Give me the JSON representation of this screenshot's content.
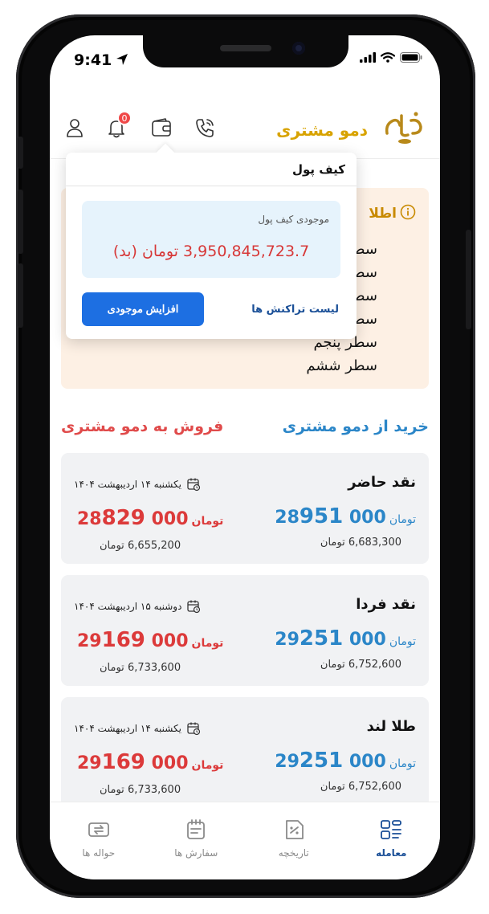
{
  "status_bar": {
    "time": "9:41"
  },
  "header": {
    "app_title": "دمو مشتری",
    "notification_count": "0"
  },
  "wallet_popup": {
    "title": "کیف پول",
    "balance_label": "موجودی کیف پول",
    "balance_amount": "3,950,845,723.7 تومان (بد)",
    "increase_button": "افزایش موجودی",
    "transactions_link": "لیست تراکنش ها"
  },
  "info_box": {
    "title": "اطلا",
    "lines": [
      "سطر",
      "سطر",
      "سطر",
      "سطر",
      "سطر پنجم",
      "سطر ششم"
    ]
  },
  "sections": {
    "buy_title": "خرید از دمو مشتری",
    "sell_title": "فروش به دمو مشتری"
  },
  "cards": [
    {
      "name": "نقد حاضر",
      "date": "یکشنبه ۱۴ اردیبهشت ۱۴۰۴",
      "buy_price_lead": "28",
      "buy_price_main": "951",
      "buy_price_tail": "000",
      "buy_unit": "تومان",
      "buy_sub": "6,683,300 تومان",
      "sell_price_lead": "28",
      "sell_price_main": "829",
      "sell_price_tail": "000",
      "sell_unit": "تومان",
      "sell_sub": "6,655,200 تومان"
    },
    {
      "name": "نقد فردا",
      "date": "دوشنبه ۱۵ اردیبهشت ۱۴۰۴",
      "buy_price_lead": "29",
      "buy_price_main": "251",
      "buy_price_tail": "000",
      "buy_unit": "تومان",
      "buy_sub": "6,752,600 تومان",
      "sell_price_lead": "29",
      "sell_price_main": "169",
      "sell_price_tail": "000",
      "sell_unit": "تومان",
      "sell_sub": "6,733,600 تومان"
    },
    {
      "name": "طلا لند",
      "date": "یکشنبه ۱۴ اردیبهشت ۱۴۰۴",
      "buy_price_lead": "29",
      "buy_price_main": "251",
      "buy_price_tail": "000",
      "buy_unit": "تومان",
      "buy_sub": "6,752,600 تومان",
      "sell_price_lead": "29",
      "sell_price_main": "169",
      "sell_price_tail": "000",
      "sell_unit": "تومان",
      "sell_sub": "6,733,600 تومان"
    }
  ],
  "bottom_nav": [
    {
      "label": "معامله",
      "icon": "trade-icon",
      "active": true
    },
    {
      "label": "تاریخچه",
      "icon": "history-icon",
      "active": false
    },
    {
      "label": "سفارش ها",
      "icon": "orders-icon",
      "active": false
    },
    {
      "label": "حواله ها",
      "icon": "transfers-icon",
      "active": false
    }
  ],
  "colors": {
    "buy": "#2b86c8",
    "sell": "#dc3a3a",
    "brand": "#d8a300",
    "primary_button": "#1d6fe2"
  }
}
